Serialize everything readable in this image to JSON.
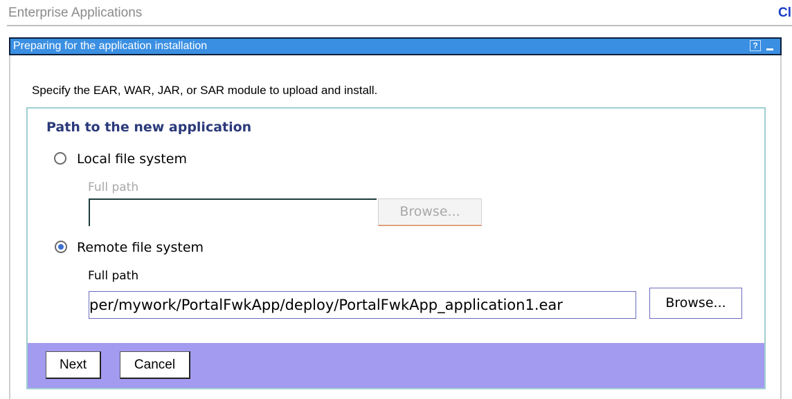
{
  "header": {
    "title": "Enterprise Applications",
    "close_link": "Cl"
  },
  "portlet": {
    "title": "Preparing for the application installation",
    "help_glyph": "?"
  },
  "instruction": "Specify the EAR, WAR, JAR, or SAR module to upload and install.",
  "form": {
    "heading": "Path to the new application",
    "local": {
      "label": "Local file system",
      "checked": false,
      "full_path_label": "Full path",
      "value": "",
      "browse_label": "Browse..."
    },
    "remote": {
      "label": "Remote file system",
      "checked": true,
      "full_path_label": "Full path",
      "value": "per/mywork/PortalFwkApp/deploy/PortalFwkApp_application1.ear",
      "browse_label": "Browse..."
    }
  },
  "actions": {
    "next_label": "Next",
    "cancel_label": "Cancel"
  },
  "colors": {
    "titlebar": "#3a8fe2",
    "button_bar": "#a39bf0",
    "heading": "#2b3a7a",
    "link": "#1a3cc8"
  }
}
